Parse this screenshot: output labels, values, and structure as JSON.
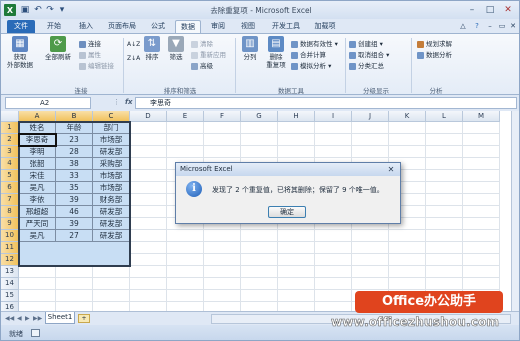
{
  "window": {
    "title": "去除重复项 - Microsoft Excel",
    "app_icon": "X",
    "minimize": "–",
    "maximize": "□",
    "close": "✕"
  },
  "tabs": [
    "文件",
    "开始",
    "插入",
    "页面布局",
    "公式",
    "数据",
    "审阅",
    "视图",
    "开发工具",
    "加载项"
  ],
  "ribbon": {
    "get_external_data": "获取\n外部数据",
    "refresh_all": "全部刷新",
    "connections": "连接",
    "properties": "属性",
    "edit_links": "编辑链接",
    "group_connections": "连接",
    "sort_asc": "A↓Z",
    "sort_desc": "Z↓A",
    "sort": "排序",
    "filter": "筛选",
    "clear": "清除",
    "reapply": "重新应用",
    "advanced": "高级",
    "group_sort_filter": "排序和筛选",
    "text_to_columns": "分列",
    "remove_duplicates": "删除\n重复项",
    "data_validation": "数据有效性 ▾",
    "consolidate": "合并计算",
    "what_if": "模拟分析 ▾",
    "group_data_tools": "数据工具",
    "group_outline_create": "创建组 ▾",
    "ungroup": "取消组合 ▾",
    "subtotal": "分类汇总",
    "group_outline": "分级显示",
    "solver": "规划求解",
    "data_analysis": "数据分析",
    "group_analysis": "分析"
  },
  "formula_bar": {
    "name_box": "A2",
    "fx": "fx",
    "content": "李思奇"
  },
  "columns": [
    "A",
    "B",
    "C",
    "D",
    "E",
    "F",
    "G",
    "H",
    "I",
    "J",
    "K",
    "L",
    "M"
  ],
  "rows": [
    "1",
    "2",
    "3",
    "4",
    "5",
    "6",
    "7",
    "8",
    "9",
    "10",
    "11",
    "12",
    "13",
    "14",
    "15",
    "16"
  ],
  "table": {
    "headers": [
      "姓名",
      "年龄",
      "部门"
    ],
    "rows": [
      [
        "李思奇",
        "23",
        "市场部"
      ],
      [
        "李明",
        "28",
        "研发部"
      ],
      [
        "张韶",
        "38",
        "采购部"
      ],
      [
        "宋佳",
        "33",
        "市场部"
      ],
      [
        "吴凡",
        "35",
        "市场部"
      ],
      [
        "李依",
        "39",
        "财务部"
      ],
      [
        "邢超超",
        "46",
        "研发部"
      ],
      [
        "严天同",
        "39",
        "研发部"
      ],
      [
        "吴凡",
        "27",
        "研发部"
      ]
    ]
  },
  "sheet_tabs": {
    "sheet1": "Sheet1",
    "new_sheet": "+"
  },
  "status": {
    "ready": "就绪"
  },
  "dialog": {
    "title": "Microsoft Excel",
    "icon": "i",
    "message": "发现了 2 个重复值，已将其删除；保留了 9 个唯一值。",
    "ok": "确定",
    "close": "✕"
  },
  "watermark": {
    "logo": "Office办公助手",
    "url": "www.officezhushou.com"
  }
}
